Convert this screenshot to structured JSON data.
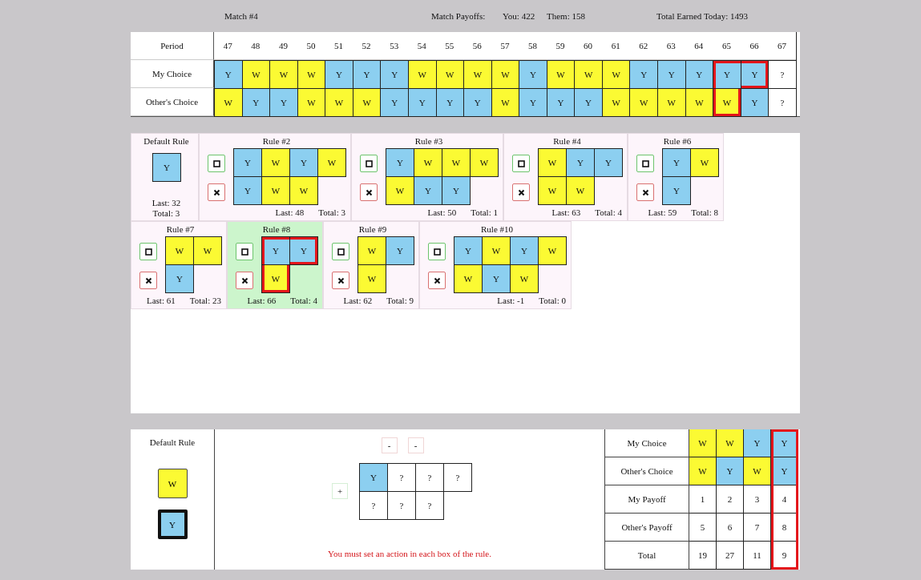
{
  "header": {
    "match": "Match #4",
    "payoffs_label": "Match Payoffs:",
    "you": "You: 422",
    "them": "Them: 158",
    "total_today": "Total Earned Today: 1493"
  },
  "history": {
    "period_label": "Period",
    "periods": [
      "47",
      "48",
      "49",
      "50",
      "51",
      "52",
      "53",
      "54",
      "55",
      "56",
      "57",
      "58",
      "59",
      "60",
      "61",
      "62",
      "63",
      "64",
      "65",
      "66",
      "67"
    ],
    "rows": [
      {
        "label": "My Choice",
        "cells": [
          {
            "label": "Y",
            "color": "#8ccff0",
            "highlighted": false
          },
          {
            "label": "W",
            "color": "#fbfa33",
            "highlighted": false
          },
          {
            "label": "W",
            "color": "#fbfa33",
            "highlighted": false
          },
          {
            "label": "W",
            "color": "#fbfa33",
            "highlighted": false
          },
          {
            "label": "Y",
            "color": "#8ccff0",
            "highlighted": false
          },
          {
            "label": "Y",
            "color": "#8ccff0",
            "highlighted": false
          },
          {
            "label": "Y",
            "color": "#8ccff0",
            "highlighted": false
          },
          {
            "label": "W",
            "color": "#fbfa33",
            "highlighted": false
          },
          {
            "label": "W",
            "color": "#fbfa33",
            "highlighted": false
          },
          {
            "label": "W",
            "color": "#fbfa33",
            "highlighted": false
          },
          {
            "label": "W",
            "color": "#fbfa33",
            "highlighted": false
          },
          {
            "label": "Y",
            "color": "#8ccff0",
            "highlighted": false
          },
          {
            "label": "W",
            "color": "#fbfa33",
            "highlighted": false
          },
          {
            "label": "W",
            "color": "#fbfa33",
            "highlighted": false
          },
          {
            "label": "W",
            "color": "#fbfa33",
            "highlighted": false
          },
          {
            "label": "Y",
            "color": "#8ccff0",
            "highlighted": false
          },
          {
            "label": "Y",
            "color": "#8ccff0",
            "highlighted": false
          },
          {
            "label": "Y",
            "color": "#8ccff0",
            "highlighted": false
          },
          {
            "label": "Y",
            "color": "#8ccff0",
            "highlighted": true
          },
          {
            "label": "Y",
            "color": "#8ccff0",
            "highlighted": true
          },
          {
            "label": "?",
            "highlighted": false
          }
        ]
      },
      {
        "label": "Other's Choice",
        "cells": [
          {
            "label": "W",
            "color": "#fbfa33",
            "highlighted": false
          },
          {
            "label": "Y",
            "color": "#8ccff0",
            "highlighted": false
          },
          {
            "label": "Y",
            "color": "#8ccff0",
            "highlighted": false
          },
          {
            "label": "W",
            "color": "#fbfa33",
            "highlighted": false
          },
          {
            "label": "W",
            "color": "#fbfa33",
            "highlighted": false
          },
          {
            "label": "W",
            "color": "#fbfa33",
            "highlighted": false
          },
          {
            "label": "Y",
            "color": "#8ccff0",
            "highlighted": false
          },
          {
            "label": "Y",
            "color": "#8ccff0",
            "highlighted": false
          },
          {
            "label": "Y",
            "color": "#8ccff0",
            "highlighted": false
          },
          {
            "label": "Y",
            "color": "#8ccff0",
            "highlighted": false
          },
          {
            "label": "W",
            "color": "#fbfa33",
            "highlighted": false
          },
          {
            "label": "Y",
            "color": "#8ccff0",
            "highlighted": false
          },
          {
            "label": "Y",
            "color": "#8ccff0",
            "highlighted": false
          },
          {
            "label": "Y",
            "color": "#8ccff0",
            "highlighted": false
          },
          {
            "label": "W",
            "color": "#fbfa33",
            "highlighted": false
          },
          {
            "label": "W",
            "color": "#fbfa33",
            "highlighted": false
          },
          {
            "label": "W",
            "color": "#fbfa33",
            "highlighted": false
          },
          {
            "label": "W",
            "color": "#fbfa33",
            "highlighted": false
          },
          {
            "label": "W",
            "color": "#fbfa33",
            "highlighted": true
          },
          {
            "label": "Y",
            "color": "#8ccff0",
            "highlighted": false
          },
          {
            "label": "?",
            "highlighted": false
          }
        ]
      }
    ]
  },
  "rule_rows": [
    [
      {
        "kind": "default",
        "title": "Default Rule",
        "selected": false,
        "last": "Last: 32",
        "total": "Total: 3",
        "cells": [
          [
            {
              "label": "Y",
              "color": "#8ccff0",
              "highlighted": false
            }
          ]
        ]
      },
      {
        "kind": "rule",
        "title": "Rule #2",
        "selected": false,
        "last": "Last: 48",
        "total": "Total: 3",
        "cells": [
          [
            {
              "label": "Y",
              "color": "#8ccff0",
              "highlighted": false
            },
            {
              "label": "W",
              "color": "#fbfa33",
              "highlighted": false
            },
            {
              "label": "Y",
              "color": "#8ccff0",
              "highlighted": false
            },
            {
              "label": "W",
              "color": "#fbfa33",
              "highlighted": false
            }
          ],
          [
            {
              "label": "Y",
              "color": "#8ccff0",
              "highlighted": false
            },
            {
              "label": "W",
              "color": "#fbfa33",
              "highlighted": false
            },
            {
              "label": "W",
              "color": "#fbfa33",
              "highlighted": false
            }
          ]
        ]
      },
      {
        "kind": "rule",
        "title": "Rule #3",
        "selected": false,
        "last": "Last: 50",
        "total": "Total: 1",
        "cells": [
          [
            {
              "label": "Y",
              "color": "#8ccff0",
              "highlighted": false
            },
            {
              "label": "W",
              "color": "#fbfa33",
              "highlighted": false
            },
            {
              "label": "W",
              "color": "#fbfa33",
              "highlighted": false
            },
            {
              "label": "W",
              "color": "#fbfa33",
              "highlighted": false
            }
          ],
          [
            {
              "label": "W",
              "color": "#fbfa33",
              "highlighted": false
            },
            {
              "label": "Y",
              "color": "#8ccff0",
              "highlighted": false
            },
            {
              "label": "Y",
              "color": "#8ccff0",
              "highlighted": false
            }
          ]
        ]
      },
      {
        "kind": "rule",
        "title": "Rule #4",
        "selected": false,
        "last": "Last: 63",
        "total": "Total: 4",
        "cells": [
          [
            {
              "label": "W",
              "color": "#fbfa33",
              "highlighted": false
            },
            {
              "label": "Y",
              "color": "#8ccff0",
              "highlighted": false
            },
            {
              "label": "Y",
              "color": "#8ccff0",
              "highlighted": false
            }
          ],
          [
            {
              "label": "W",
              "color": "#fbfa33",
              "highlighted": false
            },
            {
              "label": "W",
              "color": "#fbfa33",
              "highlighted": false
            }
          ]
        ]
      },
      {
        "kind": "rule",
        "title": "Rule #6",
        "selected": false,
        "last": "Last: 59",
        "total": "Total: 8",
        "cells": [
          [
            {
              "label": "Y",
              "color": "#8ccff0",
              "highlighted": false
            },
            {
              "label": "W",
              "color": "#fbfa33",
              "highlighted": false
            }
          ],
          [
            {
              "label": "Y",
              "color": "#8ccff0",
              "highlighted": false
            }
          ]
        ]
      }
    ],
    [
      {
        "kind": "rule",
        "title": "Rule #7",
        "selected": false,
        "last": "Last: 61",
        "total": "Total: 23",
        "cells": [
          [
            {
              "label": "W",
              "color": "#fbfa33",
              "highlighted": false
            },
            {
              "label": "W",
              "color": "#fbfa33",
              "highlighted": false
            }
          ],
          [
            {
              "label": "Y",
              "color": "#8ccff0",
              "highlighted": false
            }
          ]
        ]
      },
      {
        "kind": "rule",
        "title": "Rule #8",
        "selected": true,
        "last": "Last: 66",
        "total": "Total: 4",
        "cells": [
          [
            {
              "label": "Y",
              "color": "#8ccff0",
              "highlighted": true
            },
            {
              "label": "Y",
              "color": "#8ccff0",
              "highlighted": true
            }
          ],
          [
            {
              "label": "W",
              "color": "#fbfa33",
              "highlighted": true
            }
          ]
        ]
      },
      {
        "kind": "rule",
        "title": "Rule #9",
        "selected": false,
        "last": "Last: 62",
        "total": "Total: 9",
        "cells": [
          [
            {
              "label": "W",
              "color": "#fbfa33",
              "highlighted": false
            },
            {
              "label": "Y",
              "color": "#8ccff0",
              "highlighted": false
            }
          ],
          [
            {
              "label": "W",
              "color": "#fbfa33",
              "highlighted": false
            }
          ]
        ]
      },
      {
        "kind": "rule",
        "title": "Rule #10",
        "selected": false,
        "last": "Last: -1",
        "total": "Total: 0",
        "cells": [
          [
            {
              "label": "Y",
              "color": "#8ccff0",
              "highlighted": false
            },
            {
              "label": "W",
              "color": "#fbfa33",
              "highlighted": false
            },
            {
              "label": "Y",
              "color": "#8ccff0",
              "highlighted": false
            },
            {
              "label": "W",
              "color": "#fbfa33",
              "highlighted": false
            }
          ],
          [
            {
              "label": "W",
              "color": "#fbfa33",
              "highlighted": false
            },
            {
              "label": "Y",
              "color": "#8ccff0",
              "highlighted": false
            },
            {
              "label": "W",
              "color": "#fbfa33",
              "highlighted": false
            }
          ]
        ]
      }
    ]
  ],
  "default_rule": {
    "title": "Default Rule",
    "options": [
      {
        "label": "W",
        "color": "#fbfa33",
        "selected": false
      },
      {
        "label": "Y",
        "color": "#8ccff0",
        "selected": true
      }
    ]
  },
  "editor": {
    "minus_buttons": [
      "-",
      "-"
    ],
    "plus_button": "+",
    "cells": [
      [
        {
          "label": "Y",
          "color": "#8ccff0"
        },
        {
          "label": "?"
        },
        {
          "label": "?"
        },
        {
          "label": "?"
        }
      ],
      [
        {
          "label": "?"
        },
        {
          "label": "?"
        },
        {
          "label": "?"
        }
      ]
    ],
    "message": "You must set an action in each box of the rule."
  },
  "payoff_table": {
    "row_labels": [
      "My Choice",
      "Other's Choice",
      "My Payoff",
      "Other's Payoff",
      "Total"
    ],
    "columns": [
      {
        "highlighted": false,
        "cells": [
          {
            "label": "W",
            "color": "#fbfa33"
          },
          {
            "label": "W",
            "color": "#fbfa33"
          },
          {
            "label": "1"
          },
          {
            "label": "5"
          },
          {
            "label": "19"
          }
        ]
      },
      {
        "highlighted": false,
        "cells": [
          {
            "label": "W",
            "color": "#fbfa33"
          },
          {
            "label": "Y",
            "color": "#8ccff0"
          },
          {
            "label": "2"
          },
          {
            "label": "6"
          },
          {
            "label": "27"
          }
        ]
      },
      {
        "highlighted": false,
        "cells": [
          {
            "label": "Y",
            "color": "#8ccff0"
          },
          {
            "label": "W",
            "color": "#fbfa33"
          },
          {
            "label": "3"
          },
          {
            "label": "7"
          },
          {
            "label": "11"
          }
        ]
      },
      {
        "highlighted": true,
        "cells": [
          {
            "label": "Y",
            "color": "#8ccff0"
          },
          {
            "label": "Y",
            "color": "#8ccff0"
          },
          {
            "label": "4"
          },
          {
            "label": "8"
          },
          {
            "label": "9"
          }
        ]
      }
    ]
  }
}
